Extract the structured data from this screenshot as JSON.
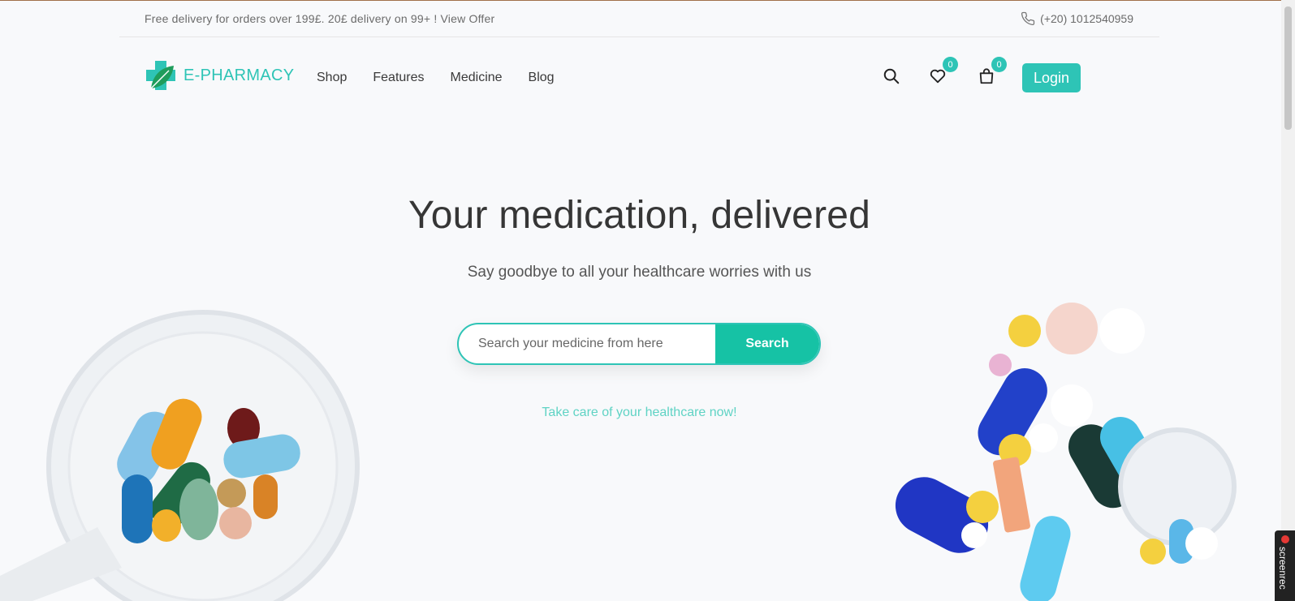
{
  "topbar": {
    "promo": "Free delivery for orders over 199£. 20£ delivery on 99+ ! View Offer",
    "phone": "(+20) 1012540959",
    "phone_icon": "phone-icon"
  },
  "header": {
    "logo_text": "E-PHARMACY",
    "nav": [
      "Shop",
      "Features",
      "Medicine",
      "Blog"
    ],
    "icons": [
      "search-icon",
      "heart-icon",
      "shopping-bag-icon"
    ],
    "wishlist_count": "0",
    "cart_count": "0",
    "login_label": "Login"
  },
  "hero": {
    "title": "Your medication, delivered",
    "subtitle": "Say goodbye to all your healthcare worries with us",
    "search_placeholder": "Search your medicine from here",
    "search_button": "Search",
    "tagline": "Take care of your healthcare now!"
  },
  "overlay": {
    "recorder_label": "screenrec"
  },
  "colors": {
    "brand": "#2ec4b6",
    "search_button": "#16c2a5",
    "text_dark": "#363636"
  }
}
